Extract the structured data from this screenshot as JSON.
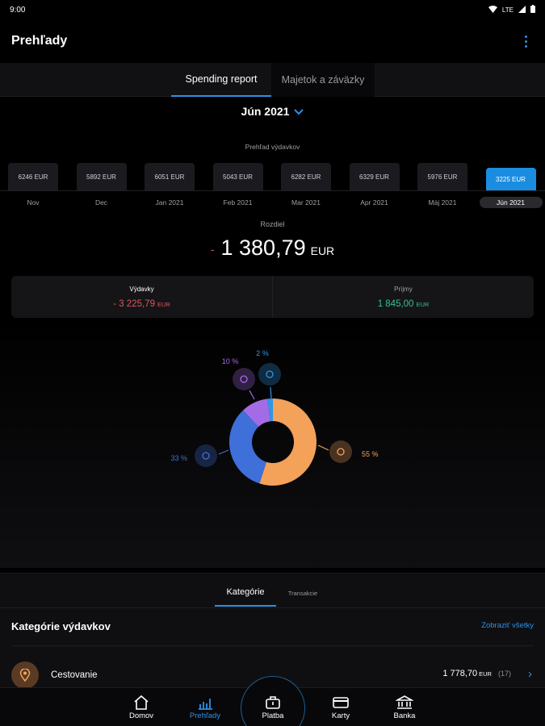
{
  "status": {
    "time": "9:00",
    "network": "LTE"
  },
  "appbar": {
    "title": "Prehľady"
  },
  "tabs": [
    {
      "label": "Spending report",
      "active": true
    },
    {
      "label": "Majetok a záväzky",
      "active": false
    }
  ],
  "period": {
    "label": "Jún 2021"
  },
  "overview": {
    "label": "Prehľad výdavkov",
    "bars": [
      {
        "value": "6246 EUR",
        "month": "Nov"
      },
      {
        "value": "5892 EUR",
        "month": "Dec"
      },
      {
        "value": "6051 EUR",
        "month": "Jan 2021"
      },
      {
        "value": "5043 EUR",
        "month": "Feb 2021"
      },
      {
        "value": "6282 EUR",
        "month": "Mar 2021"
      },
      {
        "value": "6329 EUR",
        "month": "Apr 2021"
      },
      {
        "value": "5976 EUR",
        "month": "Máj 2021"
      },
      {
        "value": "3225 EUR",
        "month": "Jún 2021",
        "active": true
      }
    ]
  },
  "difference": {
    "label": "Rozdiel",
    "sign": "-",
    "value": "1 380,79",
    "unit": "EUR"
  },
  "summary": {
    "expenses": {
      "label": "Výdavky",
      "value": "- 3 225,79",
      "unit": "EUR"
    },
    "income": {
      "label": "Príjmy",
      "value": "1 845,00",
      "unit": "EUR"
    }
  },
  "colors": {
    "accent": "#2f8fe6",
    "negative": "#e0565b",
    "positive": "#38c08d"
  },
  "chart_data": {
    "type": "pie",
    "donut": true,
    "slices": [
      {
        "percent": 55,
        "label": "55 %",
        "color": "#f4a15a",
        "icon": "map-pin-icon"
      },
      {
        "percent": 33,
        "label": "33 %",
        "color": "#3f6fd8",
        "icon": "shopping-bag-icon"
      },
      {
        "percent": 10,
        "label": "10 %",
        "color": "#a46be6",
        "icon": "shirt-icon"
      },
      {
        "percent": 2,
        "label": "2 %",
        "color": "#2f96e8",
        "icon": "fork-knife-icon"
      }
    ]
  },
  "bottom": {
    "tabs": [
      {
        "label": "Kategórie",
        "active": true
      },
      {
        "label": "Transakcie",
        "active": false
      }
    ],
    "categories_title": "Kategórie výdavkov",
    "show_all": "Zobraziť všetky",
    "categories": [
      {
        "name": "Cestovanie",
        "amount": "1 778,70",
        "unit": "EUR",
        "count": "(17)",
        "icon": "map-pin-icon"
      }
    ]
  },
  "nav": [
    {
      "label": "Domov",
      "icon": "home-icon"
    },
    {
      "label": "Prehľady",
      "icon": "bar-chart-icon",
      "active": true
    },
    {
      "label": "Platba",
      "icon": "payment-icon"
    },
    {
      "label": "Karty",
      "icon": "card-icon"
    },
    {
      "label": "Banka",
      "icon": "bank-icon"
    }
  ]
}
